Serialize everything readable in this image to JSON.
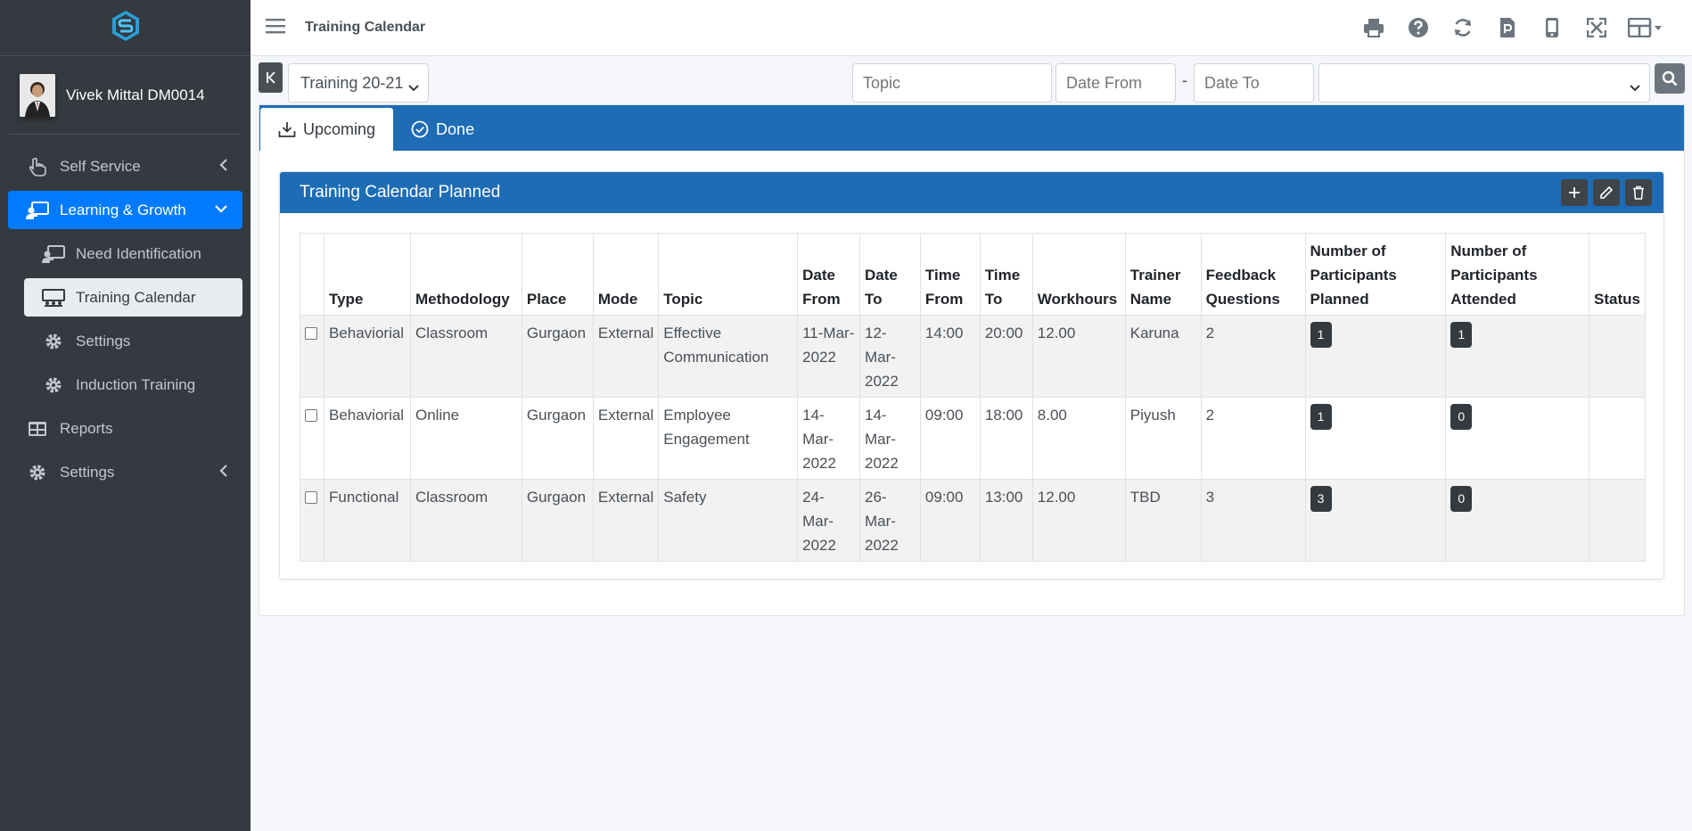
{
  "header": {
    "title": "Training Calendar"
  },
  "user": {
    "name": "Vivek Mittal DM0014"
  },
  "sidebar": {
    "items": [
      {
        "label": "Self Service"
      },
      {
        "label": "Learning & Growth"
      },
      {
        "label": "Need Identification"
      },
      {
        "label": "Training Calendar"
      },
      {
        "label": "Settings"
      },
      {
        "label": "Induction Training"
      },
      {
        "label": "Reports"
      },
      {
        "label": "Settings"
      }
    ]
  },
  "filters": {
    "session": "Training 20-21",
    "topic_placeholder": "Topic",
    "date_from_placeholder": "Date From",
    "separator": "-",
    "date_to_placeholder": "Date To"
  },
  "tabs": [
    {
      "label": "Upcoming"
    },
    {
      "label": "Done"
    }
  ],
  "card": {
    "title": "Training Calendar Planned"
  },
  "table": {
    "headers": {
      "type": "Type",
      "methodology": "Methodology",
      "place": "Place",
      "mode": "Mode",
      "topic": "Topic",
      "date_from": "Date From",
      "date_to": "Date To",
      "time_from": "Time From",
      "time_to": "Time To",
      "workhours": "Workhours",
      "trainer": "Trainer Name",
      "feedback": "Feedback Questions",
      "planned": "Number of Participants Planned",
      "attended": "Number of Participants Attended",
      "status": "Status"
    },
    "rows": [
      {
        "type": "Behaviorial",
        "methodology": "Classroom",
        "place": "Gurgaon",
        "mode": "External",
        "topic": "Effective Communication",
        "date_from": "11-Mar-2022",
        "date_to": "12-Mar-2022",
        "time_from": "14:00",
        "time_to": "20:00",
        "workhours": "12.00",
        "trainer": "Karuna",
        "feedback": "2",
        "planned": "1",
        "attended": "1",
        "status": ""
      },
      {
        "type": "Behaviorial",
        "methodology": "Online",
        "place": "Gurgaon",
        "mode": "External",
        "topic": "Employee Engagement",
        "date_from": "14-Mar-2022",
        "date_to": "14-Mar-2022",
        "time_from": "09:00",
        "time_to": "18:00",
        "workhours": "8.00",
        "trainer": "Piyush",
        "feedback": "2",
        "planned": "1",
        "attended": "0",
        "status": ""
      },
      {
        "type": "Functional",
        "methodology": "Classroom",
        "place": "Gurgaon",
        "mode": "External",
        "topic": "Safety",
        "date_from": "24-Mar-2022",
        "date_to": "26-Mar-2022",
        "time_from": "09:00",
        "time_to": "13:00",
        "workhours": "12.00",
        "trainer": "TBD",
        "feedback": "3",
        "planned": "3",
        "attended": "0",
        "status": ""
      }
    ]
  },
  "icons": {
    "logo": "logo-icon",
    "print": "print-icon",
    "help": "help-icon",
    "refresh": "refresh-icon",
    "pdf": "pdf-icon",
    "mobile": "mobile-icon",
    "fullscreen": "fullscreen-icon",
    "grid": "grid-icon"
  },
  "colors": {
    "primary": "#1e6cb5",
    "active_nav": "#007bff",
    "sidebar": "#343a40"
  }
}
